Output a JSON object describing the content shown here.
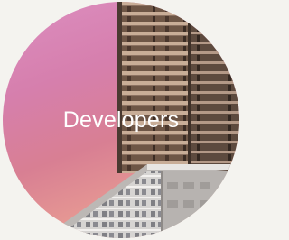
{
  "category_card": {
    "label": "Developers",
    "image_subject": "building-photo",
    "colors": {
      "sky_top": "#dc8ec0",
      "sky_bottom": "#eba39a",
      "label_text": "#ffffff",
      "page_background": "#f4f3ef"
    }
  }
}
